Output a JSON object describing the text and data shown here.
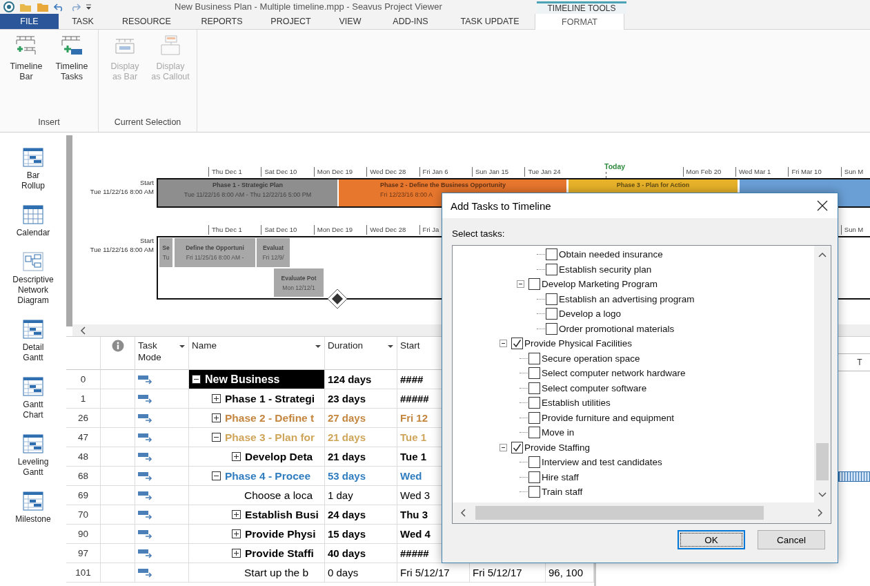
{
  "title_bar": {
    "title": "New Business Plan - Multiple timeline.mpp - Seavus Project Viewer",
    "context_label": "TIMELINE TOOLS"
  },
  "ribbon_tabs": [
    {
      "label": "FILE",
      "kind": "file",
      "selected": false
    },
    {
      "label": "TASK",
      "kind": "tab",
      "selected": false
    },
    {
      "label": "RESOURCE",
      "kind": "tab",
      "selected": false
    },
    {
      "label": "REPORTS",
      "kind": "tab",
      "selected": false
    },
    {
      "label": "PROJECT",
      "kind": "tab",
      "selected": false
    },
    {
      "label": "VIEW",
      "kind": "tab",
      "selected": false
    },
    {
      "label": "ADD-INS",
      "kind": "tab",
      "selected": false
    },
    {
      "label": "TASK UPDATE",
      "kind": "tab",
      "selected": false
    },
    {
      "label": "FORMAT",
      "kind": "tab",
      "selected": true
    }
  ],
  "ribbon_groups": [
    {
      "label": "Insert",
      "buttons": [
        {
          "lines": [
            "Timeline",
            "Bar"
          ],
          "kind": "bar",
          "disabled": false
        },
        {
          "lines": [
            "Timeline",
            "Tasks"
          ],
          "kind": "tasks",
          "disabled": false
        }
      ]
    },
    {
      "label": "Current Selection",
      "buttons": [
        {
          "lines": [
            "Display",
            "as Bar"
          ],
          "kind": "display-bar",
          "disabled": true
        },
        {
          "lines": [
            "Display",
            "as Callout"
          ],
          "kind": "display-callout",
          "disabled": true
        }
      ]
    }
  ],
  "views": [
    {
      "lines": [
        "Bar",
        "Rollup"
      ],
      "kind": "gantt"
    },
    {
      "lines": [
        "Calendar"
      ],
      "kind": "calendar"
    },
    {
      "lines": [
        "Descriptive",
        "Network",
        "Diagram"
      ],
      "kind": "network"
    },
    {
      "lines": [
        "Detail",
        "Gantt"
      ],
      "kind": "gantt"
    },
    {
      "lines": [
        "Gantt",
        "Chart"
      ],
      "kind": "gantt"
    },
    {
      "lines": [
        "Leveling",
        "Gantt"
      ],
      "kind": "gantt"
    },
    {
      "lines": [
        "Milestone"
      ],
      "kind": "gantt"
    }
  ],
  "timelines": [
    {
      "start_label": "Start",
      "start_date": "Tue 11/22/16 8:00 AM",
      "ticks": [
        "Thu Dec 1",
        "Sat Dec 10",
        "Mon Dec 19",
        "Wed Dec 28",
        "Fri Jan 6",
        "Sun Jan 15",
        "Tue Jan 24",
        "Mon Feb 20",
        "Wed Mar 1",
        "Fri Mar 10",
        "Sun M"
      ],
      "today": "Today",
      "milestone": false,
      "bars": [
        {
          "title": "Phase 1 - Strategic Plan",
          "dates": "Tue 11/22/16 8:00 AM - Thu 12/22/16 5:00 PM",
          "color": "#8e8e8e"
        },
        {
          "title": "Phase 2 - Define the Business Opportunity",
          "dates": "Fri 12/23/16 8:00 A",
          "color": "#e8772e"
        },
        {
          "title": "Phase 3 - Plan for Action",
          "color": "#e8b32a"
        },
        {
          "color": "#6a9fd6"
        }
      ]
    },
    {
      "start_label": "Start",
      "start_date": "Tue 11/22/16 8:00 AM",
      "ticks": [
        "Thu Dec 1",
        "Sat Dec 10",
        "Mon Dec 19",
        "Wed Dec 28",
        "Fri Ja",
        "Sun M"
      ],
      "milestone": true,
      "bars": [
        {
          "title": "Se",
          "dates": "Tu",
          "color": "#a8a8a8"
        },
        {
          "title": "Define the Opportuni",
          "dates": "Fri 11/25/16 8:00 AM -",
          "color": "#a8a8a8"
        },
        {
          "title": "Evaluat",
          "dates": "Fri 12/9/",
          "color": "#a8a8a8"
        },
        {
          "title": "Evaluate Pot",
          "dates": "Mon 12/12/1",
          "color": "#a8a8a8"
        }
      ]
    }
  ],
  "table": {
    "columns": [
      {
        "kind": "number"
      },
      {
        "kind": "info"
      },
      {
        "kind": "text",
        "label": "Task Mode",
        "filter": true
      },
      {
        "kind": "text",
        "label": "Name",
        "filter": true
      },
      {
        "kind": "text",
        "label": "Duration",
        "filter": true
      },
      {
        "kind": "text",
        "label": "Start"
      }
    ],
    "rows": [
      {
        "id": "0",
        "name": "New Business",
        "duration": "124 days",
        "start": "####",
        "kind": "summary",
        "expanded": true,
        "selected": true,
        "color": "#000000",
        "children": [
          {
            "id": "1",
            "name": "Phase 1 - Strategi",
            "duration": "23 days",
            "start": "#####",
            "kind": "summary",
            "expanded": false,
            "selected": false,
            "color": "#000000"
          },
          {
            "id": "26",
            "name": "Phase 2 - Define t",
            "duration": "27 days",
            "start": "Fri 12",
            "kind": "summary",
            "expanded": false,
            "selected": false,
            "color": "#c4863f"
          },
          {
            "id": "47",
            "name": "Phase 3 - Plan for",
            "duration": "21 days",
            "start": "Tue 1",
            "kind": "summary",
            "expanded": true,
            "selected": false,
            "color": "#cfa55a",
            "children": [
              {
                "id": "48",
                "name": "Develop Deta",
                "duration": "21 days",
                "start": "Tue 1",
                "kind": "summary",
                "expanded": false,
                "selected": false,
                "color": "#000000"
              }
            ]
          },
          {
            "id": "68",
            "name": "Phase 4 - Procee",
            "duration": "53 days",
            "start": "Wed",
            "kind": "summary",
            "expanded": true,
            "selected": false,
            "color": "#2f7dbf",
            "children": [
              {
                "id": "69",
                "name": "Choose a loca",
                "duration": "1 day",
                "start": "Wed 3",
                "kind": "task",
                "selected": false,
                "color": "#000000"
              },
              {
                "id": "70",
                "name": "Establish Busi",
                "duration": "24 days",
                "start": "Thu 3",
                "kind": "summary",
                "expanded": false,
                "selected": false,
                "color": "#000000"
              },
              {
                "id": "90",
                "name": "Provide Physi",
                "duration": "15 days",
                "start": "Wed 4",
                "kind": "summary",
                "expanded": false,
                "selected": false,
                "color": "#000000"
              },
              {
                "id": "97",
                "name": "Provide Staffi",
                "duration": "40 days",
                "start": "#####",
                "kind": "summary",
                "expanded": false,
                "selected": false,
                "color": "#000000"
              },
              {
                "id": "101",
                "name": "Start up the b",
                "duration": "0 days",
                "start": "Fri 5/12/17",
                "finish": "Fri 5/12/17",
                "predecessors": "96, 100",
                "kind": "task",
                "selected": false,
                "color": "#000000"
              }
            ]
          }
        ]
      }
    ]
  },
  "gantt": {
    "column_1": "T"
  },
  "dialog": {
    "title": "Add Tasks to Timeline",
    "prompt": "Select tasks:",
    "tree": [
      {
        "children": [
          {
            "children": [
              {
                "label": "Obtain needed insurance",
                "checked": false
              },
              {
                "label": "Establish security plan",
                "checked": false
              }
            ]
          },
          {
            "label": "Develop Marketing Program",
            "checked": false,
            "expanded": true,
            "children": [
              {
                "label": "Establish an advertising program",
                "checked": false
              },
              {
                "label": "Develop a logo",
                "checked": false
              },
              {
                "label": "Order promotional materials",
                "checked": false
              }
            ]
          }
        ]
      },
      {
        "label": "Provide Physical Facilities",
        "checked": true,
        "expanded": true,
        "children": [
          {
            "label": "Secure operation space",
            "checked": false
          },
          {
            "label": "Select computer network hardware",
            "checked": false
          },
          {
            "label": "Select computer software",
            "checked": false
          },
          {
            "label": "Establish utilities",
            "checked": false
          },
          {
            "label": "Provide furniture and equipment",
            "checked": false
          },
          {
            "label": "Move in",
            "checked": false
          }
        ]
      },
      {
        "label": "Provide Staffing",
        "checked": true,
        "expanded": true,
        "children": [
          {
            "label": "Interview and test candidates",
            "checked": false
          },
          {
            "label": "Hire staff",
            "checked": false
          },
          {
            "label": "Train staff",
            "checked": false
          }
        ]
      }
    ],
    "buttons": [
      {
        "label": "OK",
        "default": true
      },
      {
        "label": "Cancel",
        "default": false
      }
    ]
  }
}
